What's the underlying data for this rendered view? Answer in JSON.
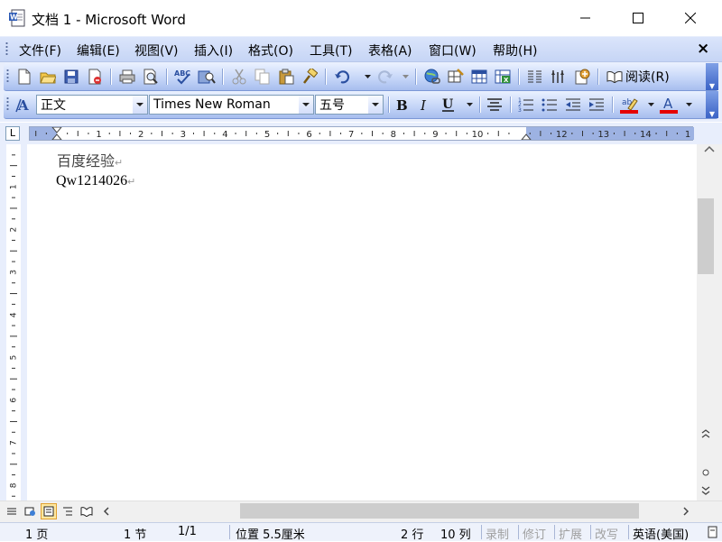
{
  "window": {
    "title": "文档 1 - Microsoft Word"
  },
  "menu": {
    "items": [
      "文件(F)",
      "编辑(E)",
      "视图(V)",
      "插入(I)",
      "格式(O)",
      "工具(T)",
      "表格(A)",
      "窗口(W)",
      "帮助(H)"
    ],
    "close_glyph": "×"
  },
  "standard_toolbar": {
    "read_label": "阅读(R)"
  },
  "format_toolbar": {
    "style": "正文",
    "font": "Times New Roman",
    "size": "五号"
  },
  "ruler": {
    "tab_selector": "L",
    "h_numbers": [
      "1",
      "2",
      "3",
      "4",
      "5",
      "6",
      "7",
      "8",
      "9",
      "10",
      "12",
      "13",
      "14",
      "1"
    ],
    "v_numbers": [
      "1",
      "2",
      "3",
      "4",
      "5",
      "6",
      "7",
      "8"
    ]
  },
  "document": {
    "lines": [
      "百度经验",
      "Qw1214026"
    ],
    "paragraph_mark": "↵"
  },
  "status": {
    "page": "1 页",
    "section": "1 节",
    "pages": "1/1",
    "position": "位置 5.5厘米",
    "line": "2 行",
    "column": "10 列",
    "rec": "录制",
    "trk": "修订",
    "ext": "扩展",
    "ovr": "改写",
    "language": "英语(美国)"
  },
  "colors": {
    "highlight": "#ffe000",
    "font_color": "#e60000",
    "accent": "#3a63c6"
  }
}
